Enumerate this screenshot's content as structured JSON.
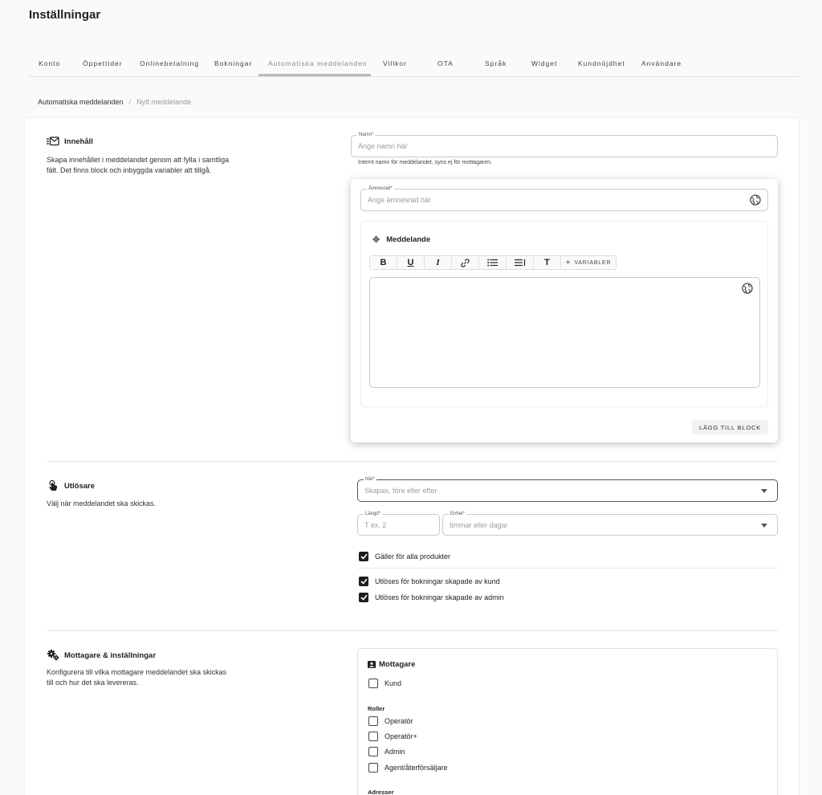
{
  "page": {
    "title": "Inställningar"
  },
  "tabs": [
    {
      "label": "Konto"
    },
    {
      "label": "Öppettider"
    },
    {
      "label": "Onlinebetalning"
    },
    {
      "label": "Bokningar"
    },
    {
      "label": "Automatiska meddelanden",
      "active": true
    },
    {
      "label": "Villkor"
    },
    {
      "label": "OTA"
    },
    {
      "label": "Språk"
    },
    {
      "label": "Widget"
    },
    {
      "label": "Kundnöjdhet"
    },
    {
      "label": "Användare"
    }
  ],
  "breadcrumb": {
    "parent": "Automatiska meddelanden",
    "separator": "/",
    "current": "Nytt meddelande"
  },
  "content": {
    "title": "Innehåll",
    "icon": "email-list-icon",
    "description": "Skapa innehållet i meddelandet genom att fylla i samtliga fält. Det finns block och inbyggda variabler att tillgå.",
    "name_field": {
      "label": "Namn*",
      "placeholder": "Ange namn här",
      "helper": "Internt namn för meddelandet, syns ej för mottagaren."
    },
    "subject_field": {
      "label": "Ämnesrad*",
      "placeholder": "Ange ämnesrad här"
    },
    "message_block": {
      "title": "Meddelande",
      "variables_label": "VARIABLER"
    },
    "add_block_label": "LÄGG TILL BLOCK"
  },
  "trigger": {
    "title": "Utlösare",
    "icon": "touch-icon",
    "description": "Välj när meddelandet ska skickas.",
    "when_field": {
      "label": "När*",
      "placeholder": "Skapas, före eller efter"
    },
    "length_field": {
      "label": "Längd*",
      "placeholder": "T ex. 2"
    },
    "unit_field": {
      "label": "Enhet*",
      "placeholder": "timmar eller dagar"
    },
    "all_products": {
      "label": "Gäller för alla produkter",
      "checked": true
    },
    "by_customer": {
      "label": "Utlöses för bokningar skapade av kund",
      "checked": true
    },
    "by_admin": {
      "label": "Utlöses för bokningar skapade av admin",
      "checked": true
    }
  },
  "recipients_section": {
    "title": "Mottagare & inställningar",
    "icon": "gears-icon",
    "description": "Konfigurera till vilka mottagare meddelandet ska skickas till och hur det ska levereras.",
    "recipients_title": "Mottagare",
    "customer": {
      "label": "Kund",
      "checked": false
    },
    "roles_title": "Roller",
    "roles": [
      {
        "label": "Operatör",
        "checked": false
      },
      {
        "label": "Operatör+",
        "checked": false
      },
      {
        "label": "Admin",
        "checked": false
      },
      {
        "label": "Agent/återförsäljare",
        "checked": false
      }
    ],
    "addresses_title": "Adresser"
  }
}
